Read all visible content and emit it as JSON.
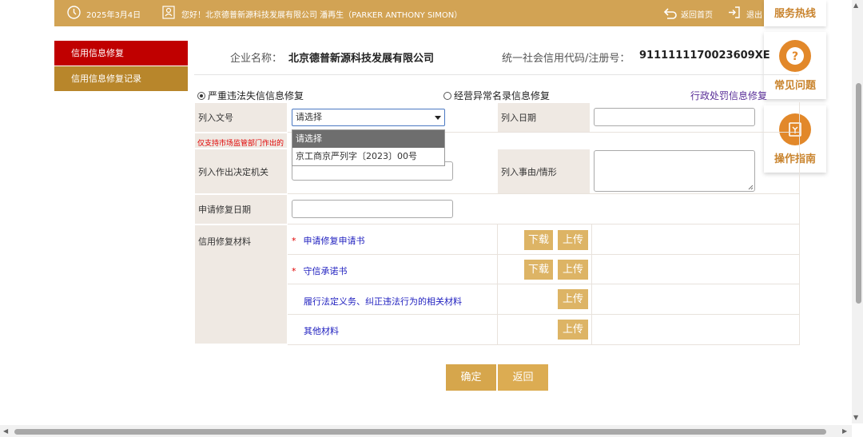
{
  "topbar": {
    "date": "2025年3月4日",
    "greeting": "您好！北京德普新源科技发展有限公司 潘再生（PARKER ANTHONY SIMON）",
    "home": "返回首页",
    "exit": "退出"
  },
  "float": {
    "hotline": "服务热线",
    "faq": "常见问题",
    "guide": "操作指南"
  },
  "sidebar": {
    "items": [
      {
        "label": "信用信息修复",
        "active": true
      },
      {
        "label": "信用信息修复记录",
        "active": false
      }
    ]
  },
  "company": {
    "name_label": "企业名称：",
    "name": "北京德普新源科技发展有限公司",
    "code_label": "统一社会信用代码/注册号：",
    "code": "9111111170023609XE"
  },
  "repair_types": {
    "serious": "严重违法失信信息修复",
    "abnormal": "经营异常名录信息修复",
    "penalty": "行政处罚信息修复",
    "selected": "serious"
  },
  "form": {
    "doc_no_label": "列入文号",
    "doc_no_value": "请选择",
    "doc_no_options": [
      "请选择",
      "京工商京严列字〔2023〕00号"
    ],
    "list_date_label": "列入日期",
    "note": "仅支持市场监管部门作出的",
    "authority_label": "列入作出决定机关",
    "reason_label": "列入事由/情形",
    "apply_date_label": "申请修复日期",
    "materials_label": "信用修复材料",
    "materials": [
      {
        "name": "申请修复申请书",
        "required": true,
        "download": "下载",
        "upload": "上传"
      },
      {
        "name": "守信承诺书",
        "required": true,
        "download": "下载",
        "upload": "上传"
      },
      {
        "name": "履行法定义务、纠正违法行为的相关材料",
        "required": false,
        "upload": "上传"
      },
      {
        "name": "其他材料",
        "required": false,
        "upload": "上传"
      }
    ]
  },
  "actions": {
    "confirm": "确定",
    "back": "返回"
  },
  "colors": {
    "topbar": "#d2a354",
    "sidebar_active": "#c00000",
    "sidebar_inactive": "#b8862b",
    "button": "#ddb465",
    "confirm": "#d6a64c",
    "back": "#dcac52"
  }
}
